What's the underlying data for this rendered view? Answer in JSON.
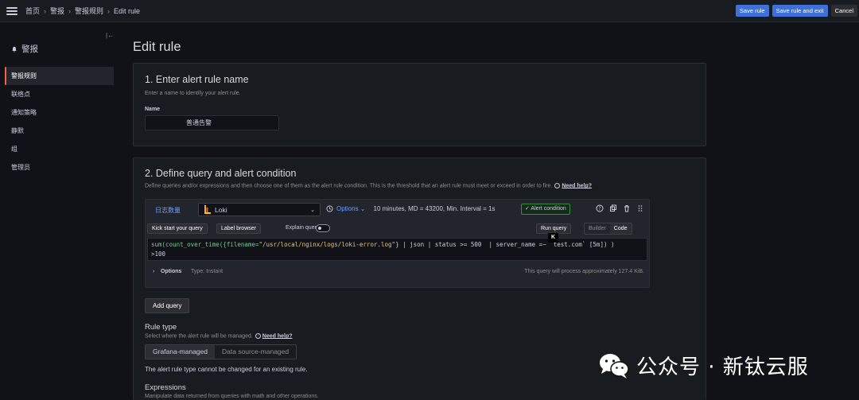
{
  "breadcrumb": [
    "首页",
    "警报",
    "警报规则",
    "Edit rule"
  ],
  "top_actions": {
    "save": "Save rule",
    "save_exit": "Save rule and exit",
    "cancel": "Cancel"
  },
  "sidebar": {
    "title": "警报",
    "items": [
      {
        "label": "警报规则",
        "active": true
      },
      {
        "label": "联络点"
      },
      {
        "label": "通知策略"
      },
      {
        "label": "静默"
      },
      {
        "label": "组"
      },
      {
        "label": "管理员"
      }
    ]
  },
  "page_title": "Edit rule",
  "section1": {
    "title": "1. Enter alert rule name",
    "desc": "Enter a name to identify your alert rule.",
    "name_label": "Name",
    "name_value": "普通告警"
  },
  "section2": {
    "title": "2. Define query and alert condition",
    "desc": "Define queries and/or expressions and then choose one of them as the alert rule condition. This is the threshold that an alert rule must meet or exceed in order to fire.",
    "help": "Need help?",
    "query": {
      "ref_id": "日志数量",
      "datasource": "Loki",
      "options_link": "Options",
      "options_info": "10 minutes, MD = 43200, Min. Interval = 1s",
      "alert_condition": "✓ Alert condition",
      "kick_start": "Kick start your query",
      "label_browser": "Label browser",
      "explain": "Explain query",
      "run": "Run query",
      "mode_builder": "Builder",
      "mode_code": "Code",
      "code_line1_fn": "sum(count_over_time({filename=",
      "code_line1_str": "\"/usr/local/nginx/logs/loki-error.log\"",
      "code_line1_rest": "} | json | status >= 500  | server_name =~ `test.com` [5m]) )",
      "code_line2": ">100",
      "k_badge": "K",
      "options_label": "Options",
      "options_type": "Type: Instant",
      "process_info": "This query will process approximately 127.4 KiB."
    },
    "add_query": "Add query",
    "rule_type": {
      "title": "Rule type",
      "desc": "Select where the alert rule will be managed.",
      "help": "Need help?",
      "opt_grafana": "Grafana-managed",
      "opt_datasource": "Data source-managed",
      "note": "The alert rule type cannot be changed for an existing rule."
    },
    "expressions": {
      "title": "Expressions",
      "desc": "Manipulate data returned from queries with math and other operations."
    }
  },
  "watermark": "公众号 · 新钛云服",
  "colors": {
    "primary": "#3d71d9",
    "active_accent": "#f55f3e",
    "link": "#6e9fff",
    "success": "#3a8a44"
  }
}
